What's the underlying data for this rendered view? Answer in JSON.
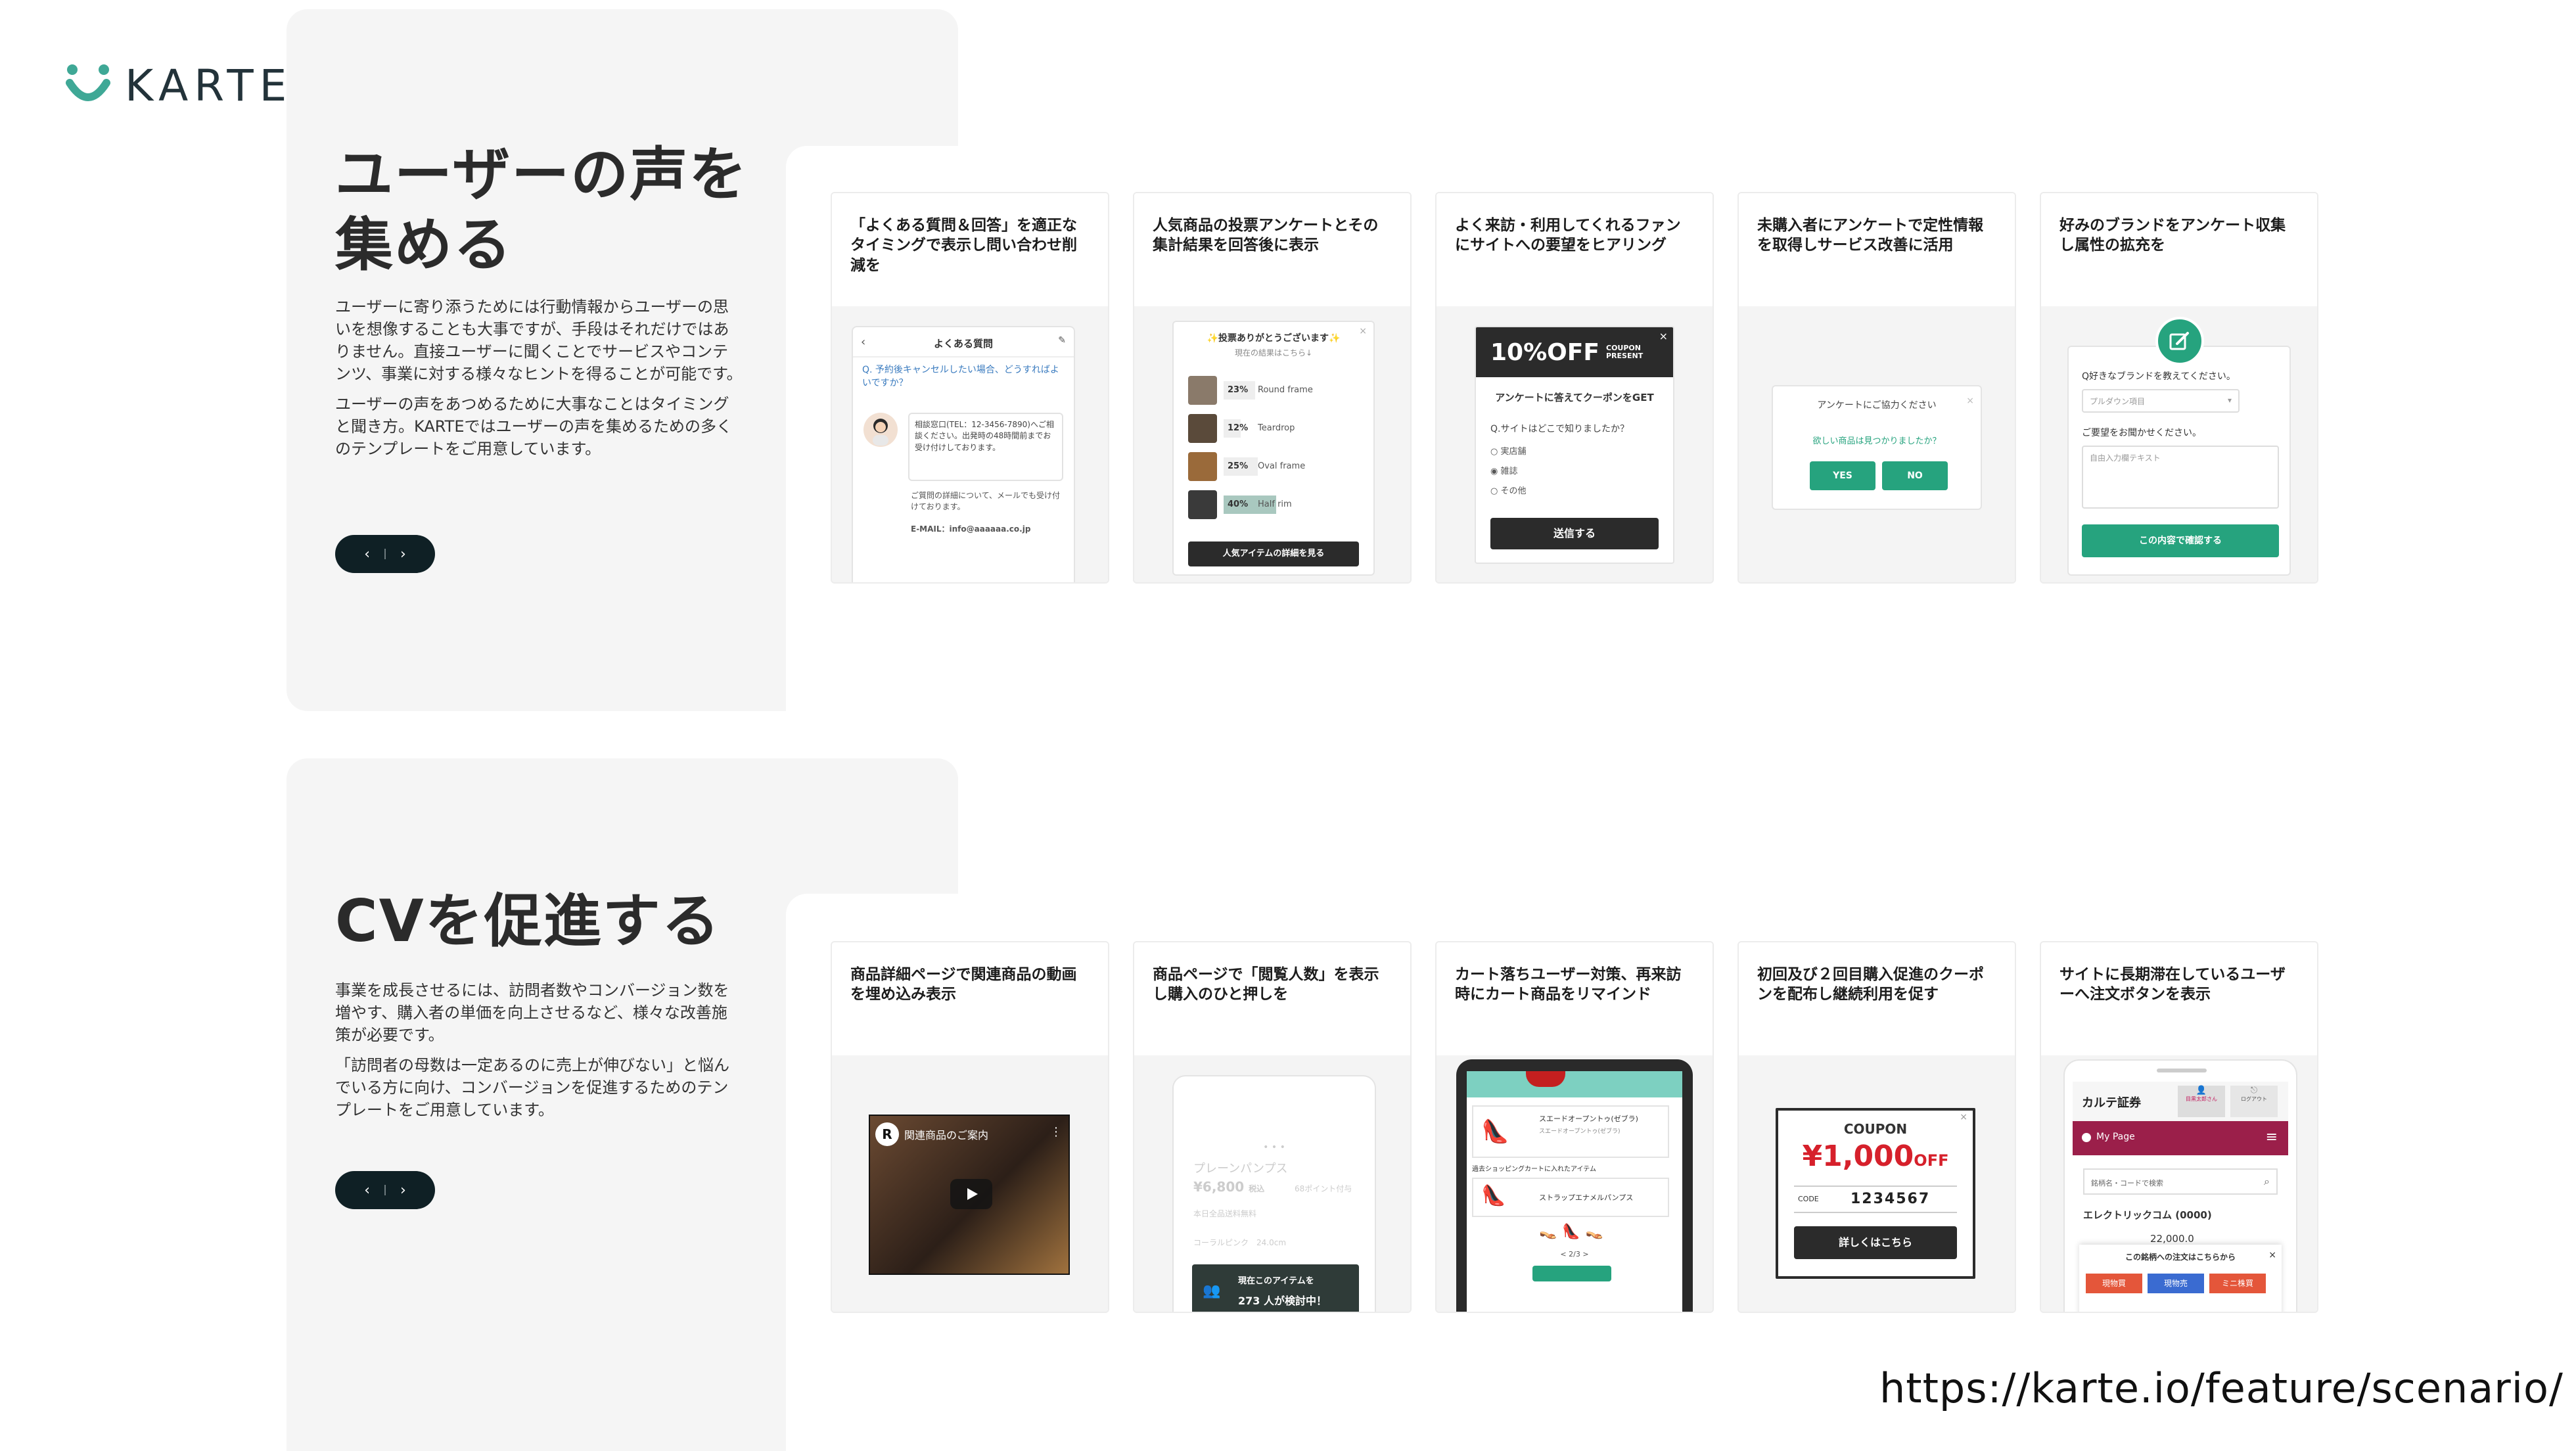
{
  "brand": {
    "name": "KARTE",
    "accent": "#3fa896"
  },
  "section1": {
    "title_line1": "ユーザーの声を",
    "title_line2": "集める",
    "body_p1": "ユーザーに寄り添うためには行動情報からユーザーの思いを想像することも大事ですが、手段はそれだけではありません。直接ユーザーに聞くことでサービスやコンテンツ、事業に対する様々なヒントを得ることが可能です。",
    "body_p2": "ユーザーの声をあつめるために大事なことはタイミングと聞き方。KARTEではユーザーの声を集めるための多くのテンプレートをご用意しています。",
    "cards": [
      {
        "caption": "「よくある質問＆回答」を適正なタイミングで表示し問い合わせ削減を",
        "mock": {
          "header": "よくある質問",
          "question": "Q. 予約後キャンセルしたい場合、どうすればよいですか？",
          "answer": "相談窓口(TEL：12-3456-7890)へご相談ください。出発時の48時間前までお受け付けしております。",
          "note": "ご質問の詳細について、メールでも受け付けております。",
          "email": "E-MAIL：info@aaaaaa.co.jp"
        }
      },
      {
        "caption": "人気商品の投票アンケートとその集計結果を回答後に表示",
        "mock": {
          "thanks": "投票ありがとうございます",
          "sub": "現在の結果はこちら↓",
          "items": [
            {
              "pct": "23%",
              "label": "Round frame"
            },
            {
              "pct": "12%",
              "label": "Teardrop"
            },
            {
              "pct": "25%",
              "label": "Oval frame"
            },
            {
              "pct": "40%",
              "label": "Half rim"
            }
          ],
          "button": "人気アイテムの詳細を見る"
        }
      },
      {
        "caption": "よく来訪・利用してくれるファンにサイトへの要望をヒアリング",
        "mock": {
          "banner": "10%OFF",
          "banner_sub": "COUPON PRESENT",
          "lead": "アンケートに答えてクーポンをGET",
          "question": "Q.サイトはどこで知りましたか？",
          "options": [
            "実店舗",
            "雑誌",
            "その他"
          ],
          "button": "送信する"
        }
      },
      {
        "caption": "未購入者にアンケートで定性情報を取得しサービス改善に活用",
        "mock": {
          "title": "アンケートにご協力ください",
          "question": "欲しい商品は見つかりましたか？",
          "yes": "YES",
          "no": "NO"
        }
      },
      {
        "caption": "好みのブランドをアンケート収集し属性の拡充を",
        "mock": {
          "question": "Q好きなブランドを教えてください。",
          "select": "プルダウン項目",
          "request": "ご要望をお聞かせください。",
          "placeholder": "自由入力欄テキスト",
          "button": "この内容で確認する"
        }
      }
    ]
  },
  "section2": {
    "title": "CVを促進する",
    "body_p1": "事業を成長させるには、訪問者数やコンバージョン数を増やす、購入者の単価を向上させるなど、様々な改善施策が必要です。",
    "body_p2": "「訪問者の母数は一定あるのに売上が伸びない」と悩んでいる方に向け、コンバージョンを促進するためのテンプレートをご用意しています。",
    "cards": [
      {
        "caption": "商品詳細ページで関連商品の動画を埋め込み表示",
        "mock": {
          "video_title": "関連商品のご案内"
        }
      },
      {
        "caption": "商品ページで「閲覧人数」を表示し購入のひと押しを",
        "mock": {
          "product": "プレーンパンプス",
          "price": "¥6,800",
          "price_tax": "税込",
          "points": "68ポイント付与",
          "shipping": "本日全品送料無料",
          "variant": "コーラルピンク　24.0cm",
          "badge_line1": "現在このアイテムを",
          "badge_line2": "273 人が検討中！"
        }
      },
      {
        "caption": "カート落ちユーザー対策、再来訪時にカート商品をリマインド",
        "mock": {
          "item1": "スエードオープントゥ(ゼブラ)",
          "item1_sub": "スエードオープントゥ(ゼブラ)",
          "cart_note": "過去ショッピングカートに入れたアイテム",
          "item2": "ストラップエナメルパンプス",
          "pager": "< 2/3 >"
        }
      },
      {
        "caption": "初回及び２回目購入促進のクーポンを配布し継続利用を促す",
        "mock": {
          "coupon": "COUPON",
          "amount": "¥1,000",
          "off": "OFF",
          "code_label": "CODE",
          "code": "1234567",
          "button": "詳しくはこちら"
        }
      },
      {
        "caption": "サイトに長期滞在しているユーザーへ注文ボタンを表示",
        "mock": {
          "logo": "カルテ証券",
          "user": "目黒太郎さん",
          "logout": "ログアウト",
          "nav": "My Page",
          "search": "銘柄名・コードで検索",
          "stock": "エレクトリックコム (0000)",
          "price": "22,000.0",
          "popup": "この銘柄への注文はこちらから",
          "b1": "現物買",
          "b2": "現物売",
          "b3": "ミニ株買"
        }
      }
    ]
  },
  "footer": {
    "url": "https://karte.io/feature/scenario/"
  }
}
